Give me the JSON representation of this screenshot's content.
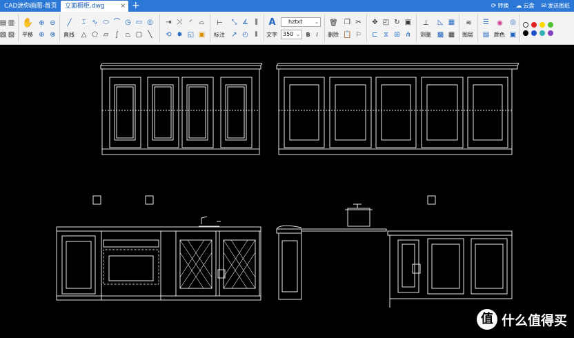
{
  "titlebar": {
    "tabs": [
      {
        "label": "CAD迷你画图-首页"
      },
      {
        "label": "立面橱柜.dwg",
        "active": true
      }
    ],
    "add_tab": "+",
    "close_tab": "×",
    "actions": [
      {
        "icon": "convert-icon",
        "label": "转换"
      },
      {
        "icon": "cloud-icon",
        "label": "云盘"
      },
      {
        "icon": "feedback-icon",
        "label": "发送图纸"
      }
    ]
  },
  "toolbar": {
    "groups": {
      "pan": {
        "label": "平移"
      },
      "line": {
        "label": "直线"
      },
      "dimension": {
        "label": "标注"
      },
      "text": {
        "label": "文字"
      },
      "delete": {
        "label": "删除"
      },
      "measure": {
        "label": "测量"
      },
      "layer": {
        "label": "图层"
      },
      "color": {
        "label": "颜色"
      }
    },
    "font_value": "hztxt",
    "size_value": "350",
    "bold_label": "B",
    "italic_label": "I",
    "palette": [
      "#ffffff",
      "#e02020",
      "#ffd800",
      "#50c030",
      "#000000",
      "#2050d0",
      "#30b0b0",
      "#8040c0"
    ]
  },
  "watermark": {
    "logo": "值",
    "text": "什么值得买"
  }
}
